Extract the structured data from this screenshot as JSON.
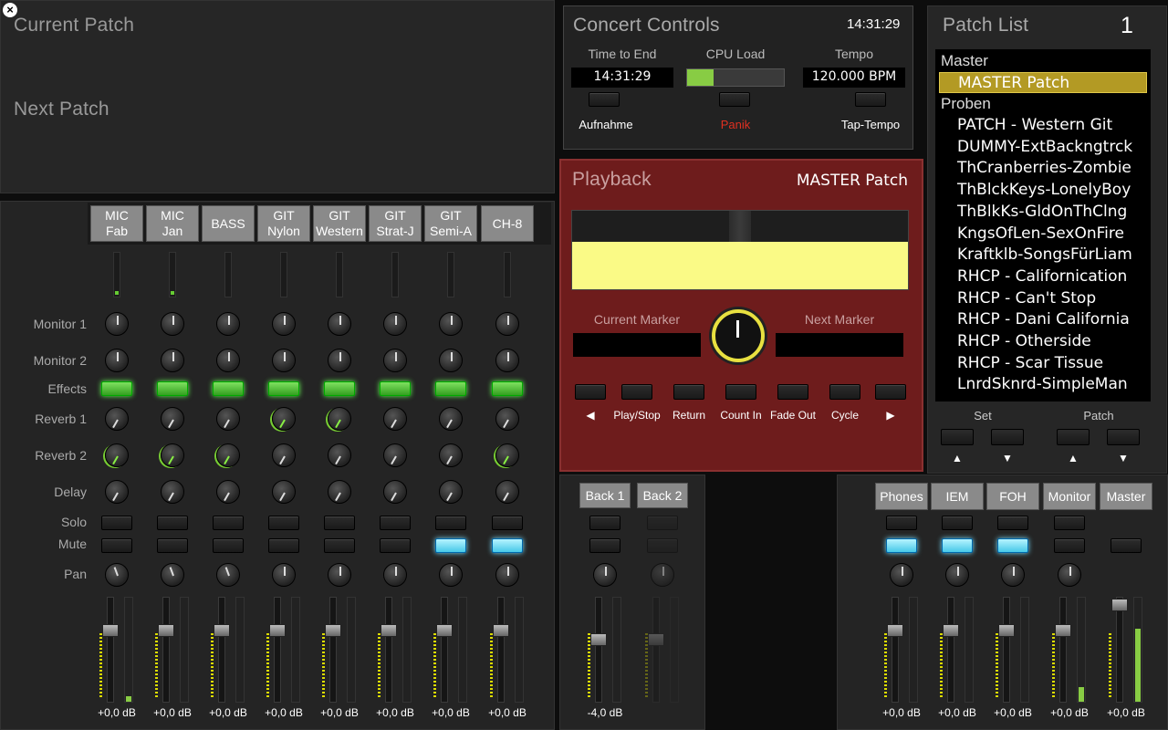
{
  "current_patch_label": "Current Patch",
  "next_patch_label": "Next Patch",
  "concert": {
    "title": "Concert Controls",
    "clock": "14:31:29",
    "time_to_end_label": "Time to End",
    "time_to_end": "14:31:29",
    "cpu_label": "CPU Load",
    "cpu_load_fraction": 0.27,
    "tempo_label": "Tempo",
    "tempo": "120.000 BPM",
    "record_label": "Aufnahme",
    "panic_label": "Panik",
    "tap_label": "Tap-Tempo"
  },
  "playback": {
    "title": "Playback",
    "patch_name": "MASTER Patch",
    "current_marker_label": "Current Marker",
    "next_marker_label": "Next Marker",
    "transport": [
      "◀",
      "Play/Stop",
      "Return",
      "Count In",
      "Fade Out",
      "Cycle",
      "▶"
    ]
  },
  "patch_list": {
    "title": "Patch List",
    "number": "1",
    "groups": [
      {
        "name": "Master",
        "items": [
          "MASTER Patch"
        ]
      },
      {
        "name": "Proben",
        "items": [
          "PATCH - Western Git",
          "DUMMY-ExtBackngtrck",
          "ThCranberries-Zombie",
          "ThBlckKeys-LonelyBoy",
          "ThBlkKs-GldOnThClng",
          "KngsOfLen-SexOnFire",
          "Kraftklb-SongsFürLiam",
          "RHCP - Californication",
          "RHCP - Can't Stop",
          "RHCP - Dani California",
          "RHCP - Otherside",
          "RHCP - Scar Tissue",
          "LnrdSknrd-SimpleMan"
        ]
      }
    ],
    "selected": "MASTER Patch",
    "set_label": "Set",
    "patch_label": "Patch",
    "up": "▲",
    "down": "▼"
  },
  "mixer": {
    "row_labels": [
      "Monitor 1",
      "Monitor 2",
      "Effects",
      "Reverb 1",
      "Reverb 2",
      "Delay",
      "Solo",
      "Mute",
      "Pan"
    ],
    "channels": [
      {
        "line1": "MIC",
        "line2": "Fab",
        "db": "+0,0 dB",
        "mute": false,
        "meter": true
      },
      {
        "line1": "MIC",
        "line2": "Jan",
        "db": "+0,0 dB",
        "mute": false,
        "meter": true
      },
      {
        "line1": "BASS",
        "line2": "",
        "db": "+0,0 dB",
        "mute": false,
        "meter": false
      },
      {
        "line1": "GIT",
        "line2": "Nylon",
        "db": "+0,0 dB",
        "mute": false,
        "meter": false
      },
      {
        "line1": "GIT",
        "line2": "Western",
        "db": "+0,0 dB",
        "mute": false,
        "meter": false
      },
      {
        "line1": "GIT",
        "line2": "Strat-J",
        "db": "+0,0 dB",
        "mute": false,
        "meter": false
      },
      {
        "line1": "GIT",
        "line2": "Semi-A",
        "db": "+0,0 dB",
        "mute": true,
        "meter": false
      },
      {
        "line1": "CH-8",
        "line2": "",
        "db": "+0,0 dB",
        "mute": true,
        "meter": false
      }
    ]
  },
  "aux": {
    "buses": [
      {
        "label": "Back 1",
        "db": "-4,0 dB"
      },
      {
        "label": "Back 2",
        "db": ""
      }
    ]
  },
  "outputs": {
    "buses": [
      {
        "label": "Phones",
        "db": "+0,0 dB"
      },
      {
        "label": "IEM",
        "db": "+0,0 dB"
      },
      {
        "label": "FOH",
        "db": "+0,0 dB"
      },
      {
        "label": "Monitor",
        "db": "+0,0 dB"
      },
      {
        "label": "Master",
        "db": "+0,0 dB"
      }
    ]
  },
  "colors": {
    "accent_green": "#66ee44",
    "mute_cyan": "#7fe0ff",
    "panic_red": "#e03020",
    "selected_gold": "#b39a24",
    "playback_red": "#6e1c1c"
  }
}
